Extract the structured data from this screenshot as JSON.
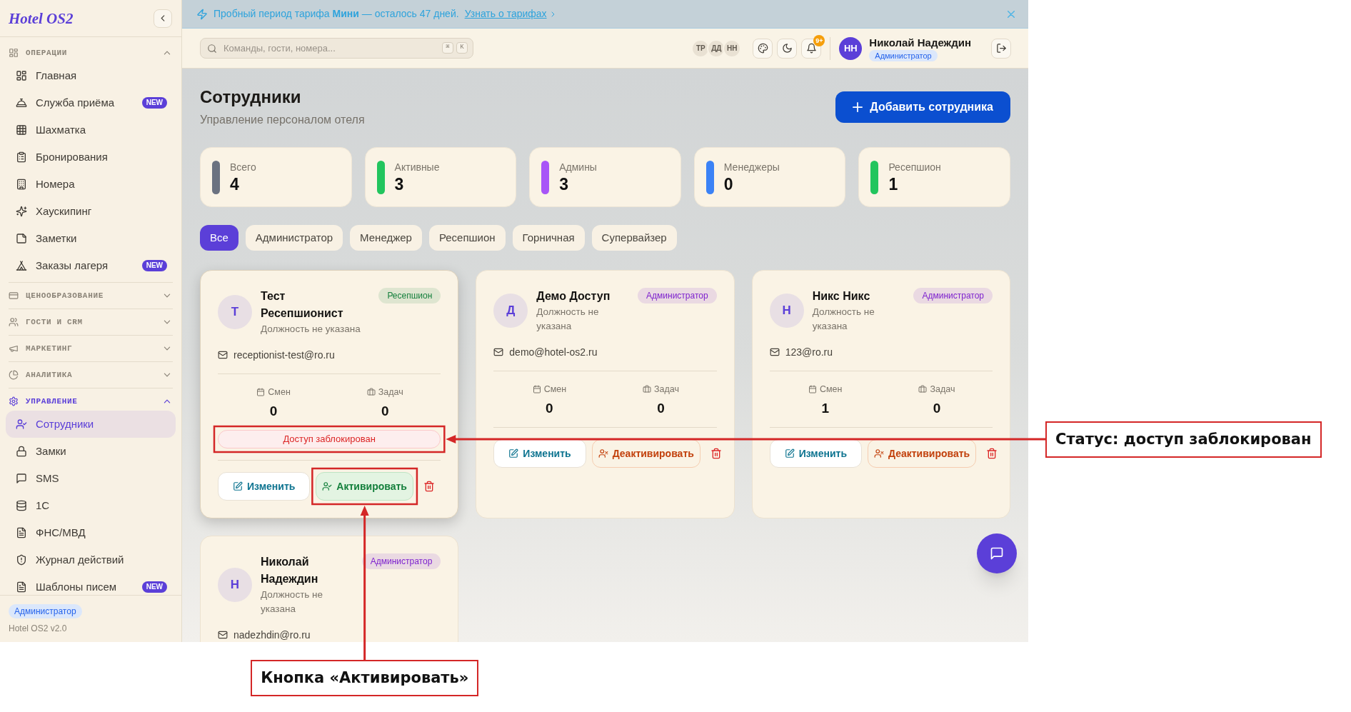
{
  "sidebar": {
    "logo": "Hotel OS2",
    "sections": [
      {
        "title": "ОПЕРАЦИИ",
        "expanded": true,
        "items": [
          {
            "label": "Главная",
            "selected": false
          },
          {
            "label": "Служба приёма",
            "badge": "NEW",
            "selected": false
          },
          {
            "label": "Шахматка",
            "selected": false
          },
          {
            "label": "Бронирования",
            "selected": false
          },
          {
            "label": "Номера",
            "selected": false
          },
          {
            "label": "Хаускипинг",
            "selected": false
          },
          {
            "label": "Заметки",
            "selected": false
          },
          {
            "label": "Заказы лагеря",
            "badge": "NEW",
            "selected": false
          }
        ]
      },
      {
        "title": "ЦЕНООБРАЗОВАНИЕ",
        "expanded": false
      },
      {
        "title": "ГОСТИ И CRM",
        "expanded": false
      },
      {
        "title": "МАРКЕТИНГ",
        "expanded": false
      },
      {
        "title": "АНАЛИТИКА",
        "expanded": false
      },
      {
        "title": "УПРАВЛЕНИЕ",
        "expanded": true,
        "items": [
          {
            "label": "Сотрудники",
            "selected": true
          },
          {
            "label": "Замки",
            "selected": false
          },
          {
            "label": "SMS",
            "selected": false
          },
          {
            "label": "1С",
            "selected": false
          },
          {
            "label": "ФНС/МВД",
            "selected": false
          },
          {
            "label": "Журнал действий",
            "selected": false
          },
          {
            "label": "Шаблоны писем",
            "badge": "NEW",
            "selected": false
          }
        ]
      }
    ],
    "footer": {
      "role": "Администратор",
      "version": "Hotel OS2 v2.0"
    }
  },
  "trial_banner": {
    "text": "Пробный период тарифа **Мини** — осталось 47 дней.",
    "link": "Узнать о тарифах"
  },
  "header": {
    "search": {
      "placeholder": "Команды, гости, номера...",
      "shortcut": [
        "⌘",
        "K"
      ]
    },
    "online_users": [
      "ТР",
      "ДД",
      "НН"
    ],
    "notifications_badge": "9+",
    "user": {
      "initials": "НН",
      "name": "Николай Надеждин",
      "role": "Администратор"
    }
  },
  "page": {
    "title": "Сотрудники",
    "subtitle": "Управление персоналом отеля",
    "add_button": "Добавить сотрудника"
  },
  "stats": [
    {
      "label": "Всего",
      "value": "4",
      "color": "#6b7280"
    },
    {
      "label": "Активные",
      "value": "3",
      "color": "#22c55e"
    },
    {
      "label": "Админы",
      "value": "3",
      "color": "#a855f7"
    },
    {
      "label": "Менеджеры",
      "value": "0",
      "color": "#3b82f6"
    },
    {
      "label": "Ресепшион",
      "value": "1",
      "color": "#22c55e"
    }
  ],
  "role_filters": [
    {
      "label": "Все",
      "selected": true
    },
    {
      "label": "Администратор",
      "selected": false
    },
    {
      "label": "Менеджер",
      "selected": false
    },
    {
      "label": "Ресепшион",
      "selected": false
    },
    {
      "label": "Горничная",
      "selected": false
    },
    {
      "label": "Супервайзер",
      "selected": false
    }
  ],
  "employees": [
    {
      "initials": "Т",
      "name": "Тест Ресепшионист",
      "position": "Должность не указана",
      "role": {
        "label": "Ресепшион",
        "color": "#15803d"
      },
      "email": "receptionist-test@ro.ru",
      "hovered": true,
      "stats": [
        {
          "label": "Смен",
          "value": "0"
        },
        {
          "label": "Задач",
          "value": "0"
        }
      ],
      "status": "Доступ заблокирован",
      "buttons": [
        {
          "label": "Изменить",
          "kind": "edit"
        },
        {
          "label": "Активировать",
          "kind": "activate"
        }
      ]
    },
    {
      "initials": "Д",
      "name": "Демо Доступ",
      "position": "Должность не указана",
      "role": {
        "label": "Администратор",
        "color": "#7e22ce"
      },
      "email": "demo@hotel-os2.ru",
      "hovered": false,
      "stats": [
        {
          "label": "Смен",
          "value": "0"
        },
        {
          "label": "Задач",
          "value": "0"
        }
      ],
      "buttons": [
        {
          "label": "Изменить",
          "kind": "edit"
        },
        {
          "label": "Деактивировать",
          "kind": "deactivate"
        }
      ]
    },
    {
      "initials": "Н",
      "name": "Никс Никс",
      "position": "Должность не указана",
      "role": {
        "label": "Администратор",
        "color": "#7e22ce"
      },
      "email": "123@ro.ru",
      "hovered": false,
      "stats": [
        {
          "label": "Смен",
          "value": "1"
        },
        {
          "label": "Задач",
          "value": "0"
        }
      ],
      "buttons": [
        {
          "label": "Изменить",
          "kind": "edit"
        },
        {
          "label": "Деактивировать",
          "kind": "deactivate"
        }
      ]
    },
    {
      "initials": "Н",
      "name": "Николай Надеждин",
      "position": "Должность не указана",
      "role": {
        "label": "Администратор",
        "color": "#7e22ce"
      },
      "email": "nadezhdin@ro.ru",
      "hovered": false
    }
  ],
  "annotations": [
    {
      "text": "Статус: доступ заблокирован",
      "kind": "status"
    },
    {
      "text": "Кнопка «Активировать»",
      "kind": "activate_button"
    }
  ]
}
